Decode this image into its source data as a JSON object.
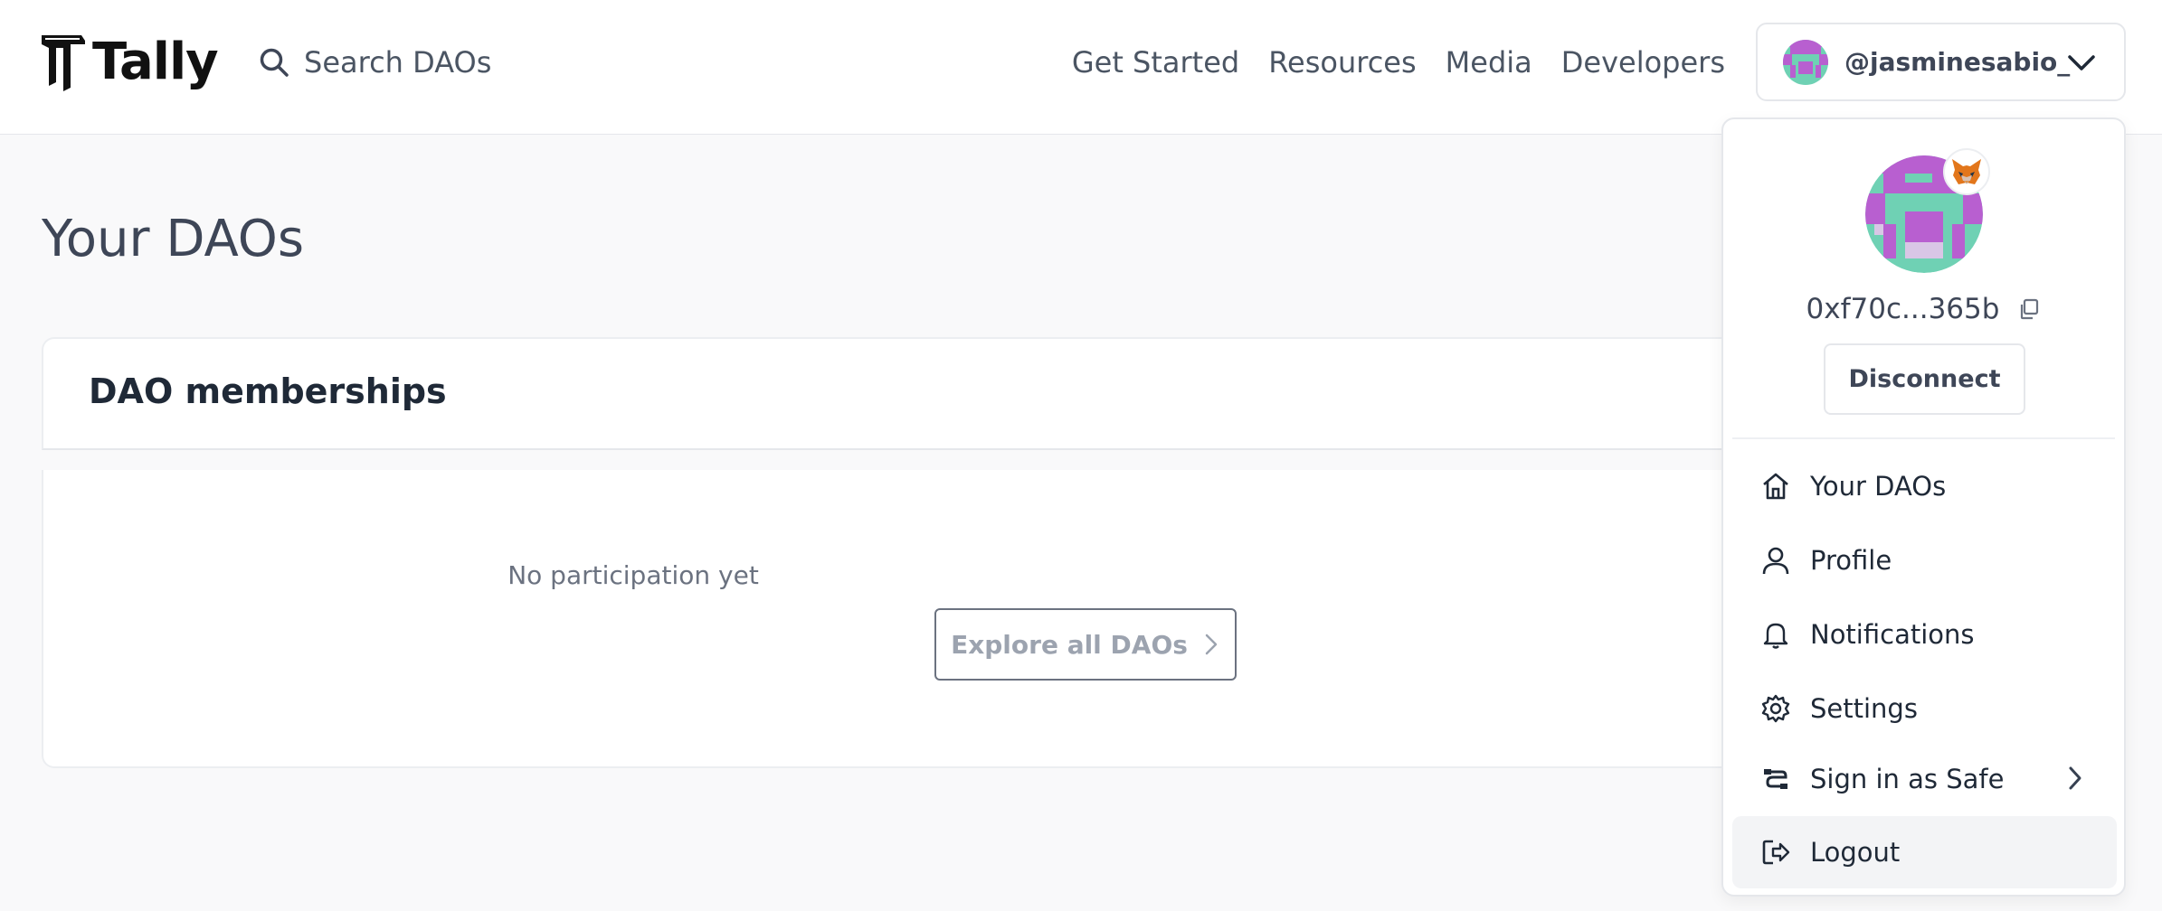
{
  "header": {
    "logo_text": "Tally",
    "search_placeholder": "Search DAOs",
    "nav": [
      "Get Started",
      "Resources",
      "Media",
      "Developers"
    ],
    "account_name": "@jasminesabio_"
  },
  "main": {
    "page_title": "Your DAOs",
    "card_title": "DAO memberships",
    "empty_text": "No participation yet",
    "explore_label": "Explore all DAOs"
  },
  "dropdown": {
    "address": "0xf70c...365b",
    "disconnect_label": "Disconnect",
    "items": [
      {
        "label": "Your DAOs",
        "icon": "home-icon"
      },
      {
        "label": "Profile",
        "icon": "user-icon"
      },
      {
        "label": "Notifications",
        "icon": "bell-icon"
      },
      {
        "label": "Settings",
        "icon": "gear-icon"
      },
      {
        "label": "Sign in as Safe",
        "icon": "safe-icon"
      },
      {
        "label": "Logout",
        "icon": "logout-icon"
      }
    ]
  },
  "colors": {
    "avatar_purple": "#b85fd0",
    "avatar_teal": "#6fd1b4",
    "text_main": "#3e4657",
    "hover_bg": "#f3f4f6"
  }
}
